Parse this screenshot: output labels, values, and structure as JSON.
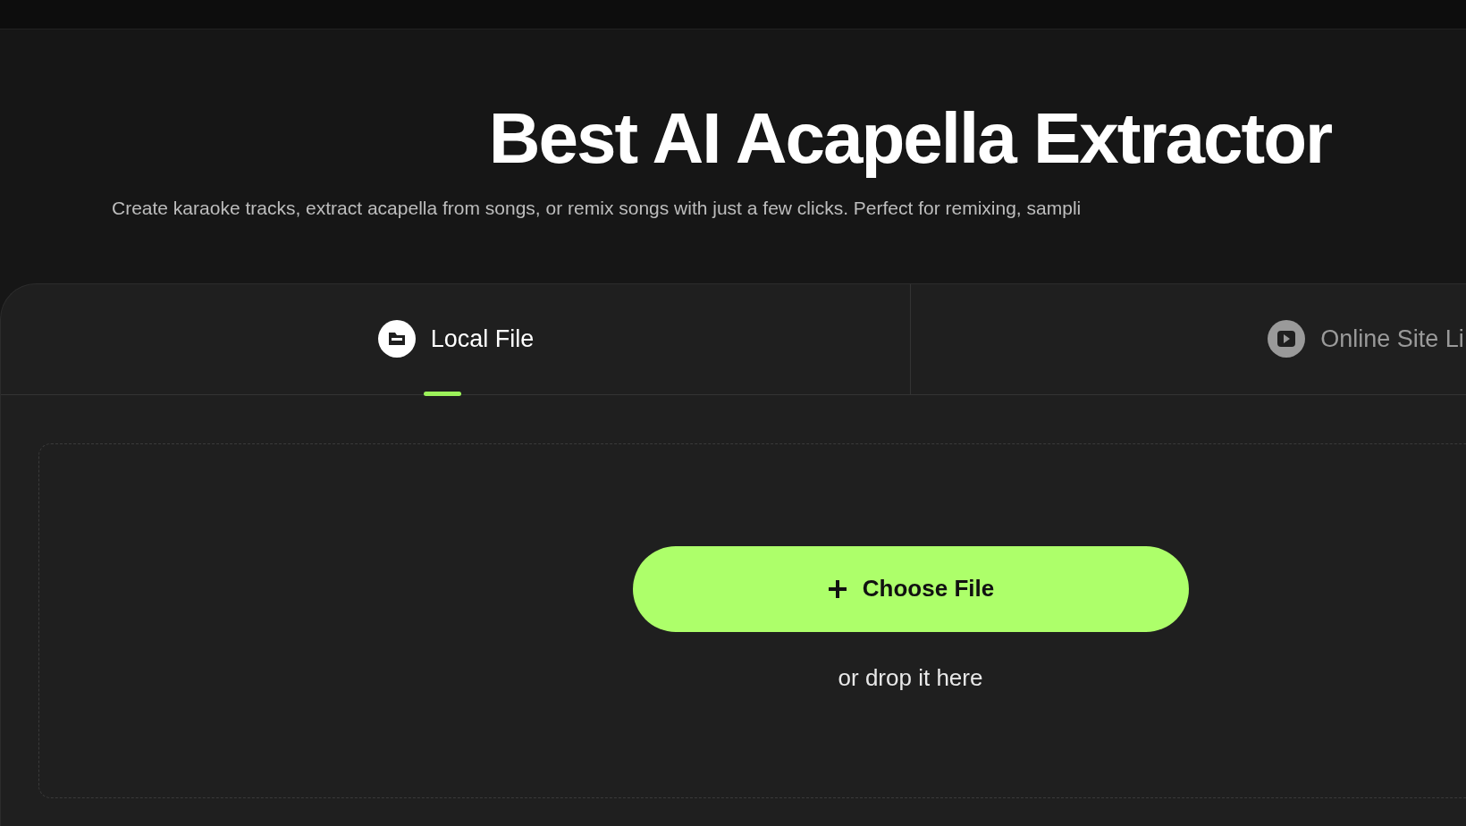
{
  "hero": {
    "title": "Best AI Acapella Extractor",
    "subtitle": "Create karaoke tracks, extract acapella from songs, or remix songs with just a few clicks. Perfect for remixing, sampli"
  },
  "tabs": [
    {
      "label": "Local File",
      "kind": "file",
      "selected": true
    },
    {
      "label": "Online Site Li",
      "kind": "video",
      "selected": false
    }
  ],
  "upload": {
    "button": "Choose File",
    "hint": "or drop it here"
  }
}
